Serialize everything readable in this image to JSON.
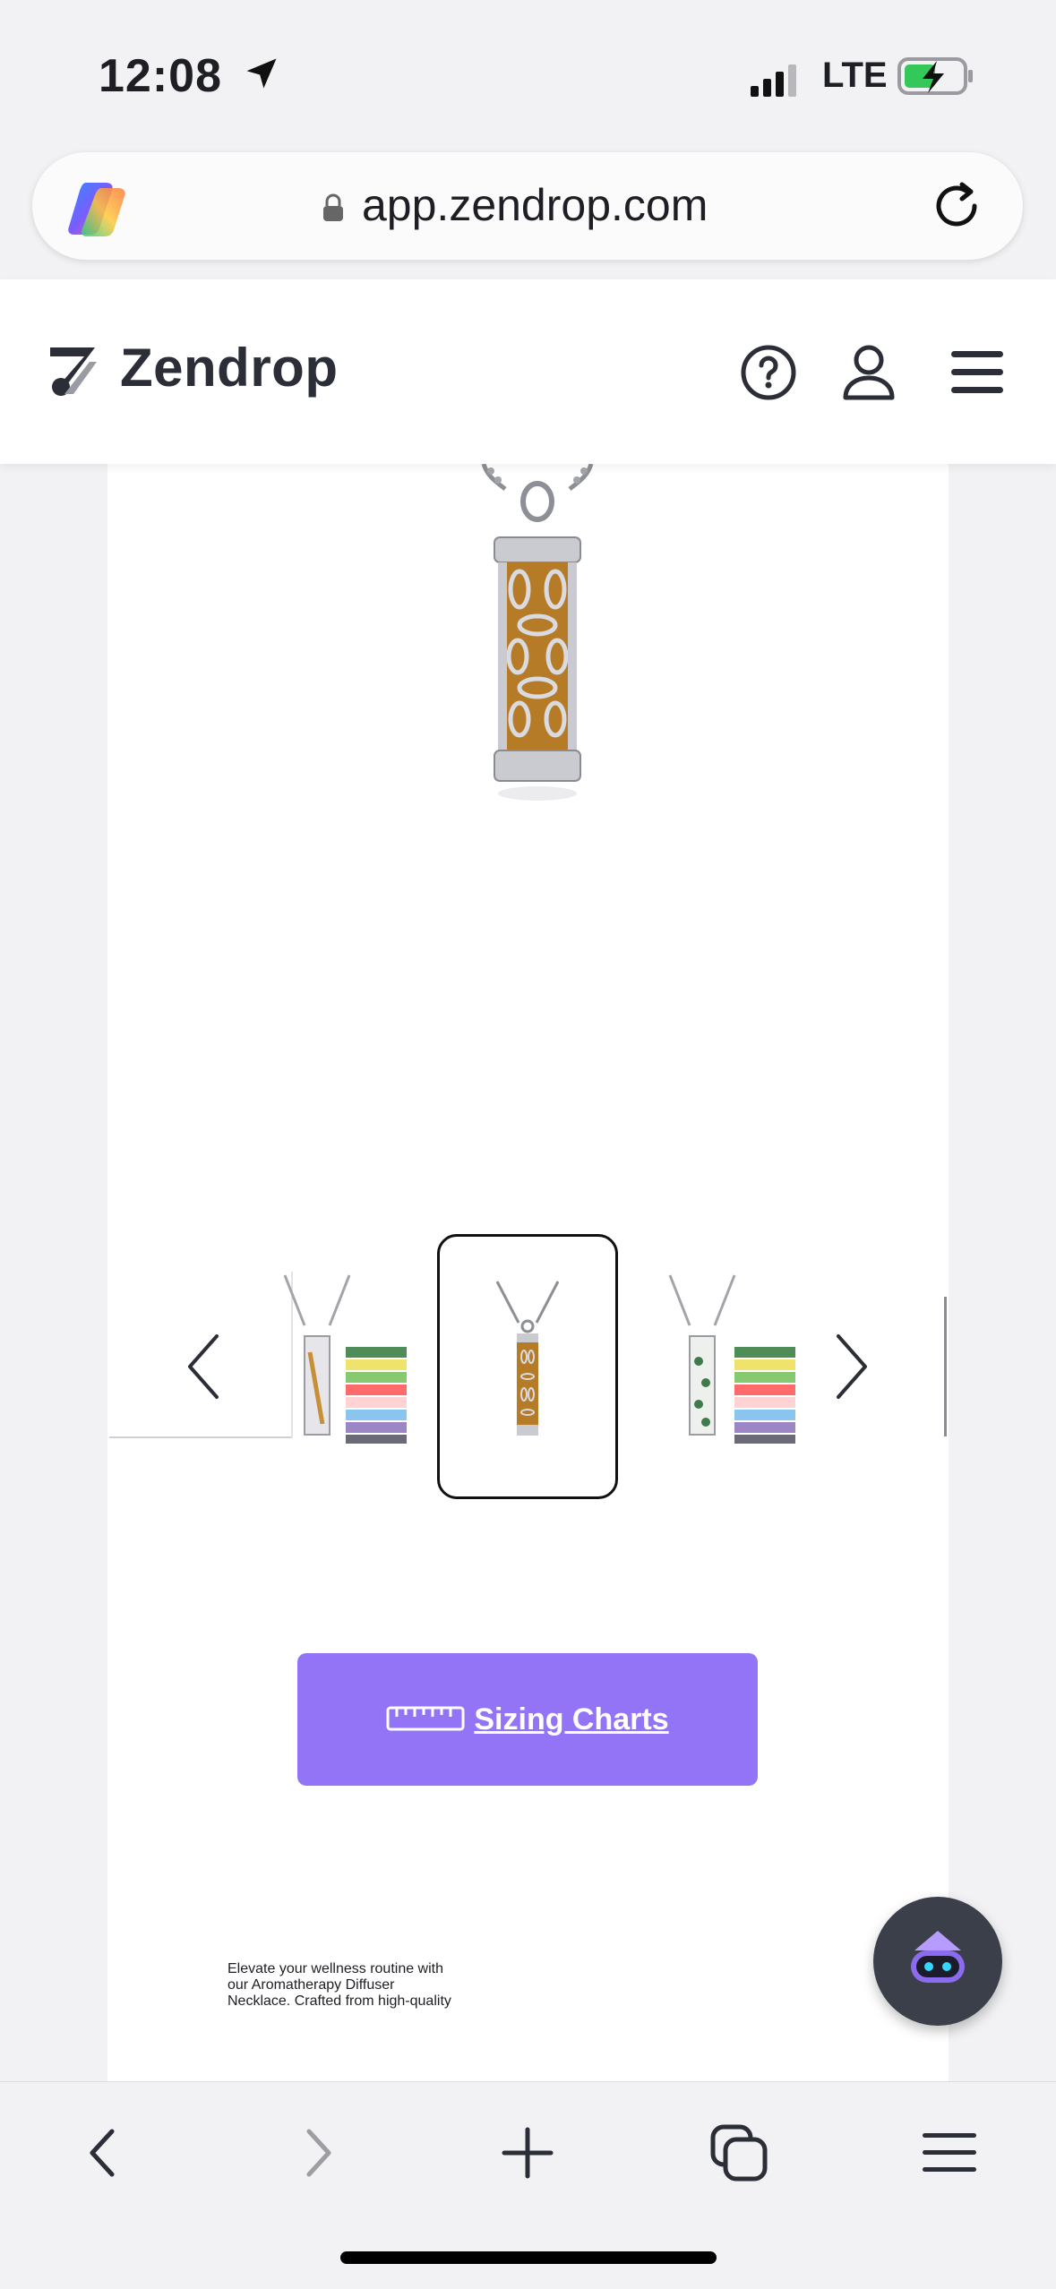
{
  "status_bar": {
    "time": "12:08",
    "network": "LTE",
    "icons": [
      "location-arrow-icon",
      "signal-bars-icon",
      "battery-charging-icon"
    ]
  },
  "browser": {
    "url": "app.zendrop.com",
    "icons": [
      "copilot-logo-icon",
      "lock-icon",
      "reload-icon"
    ]
  },
  "site_header": {
    "brand": "Zendrop",
    "icons": [
      "zendrop-logo-icon",
      "help-icon",
      "user-icon",
      "hamburger-menu-icon"
    ]
  },
  "product": {
    "description_lines": [
      "Elevate your wellness routine with",
      "our Aromatherapy Diffuser",
      "Necklace. Crafted from high-quality"
    ],
    "sizing_button_label": "Sizing Charts",
    "carousel": {
      "selected_index": 1,
      "thumbnail_count": 3
    }
  },
  "toolbar": {
    "items": [
      "back-icon",
      "forward-icon",
      "new-tab-icon",
      "tabs-icon",
      "menu-icon"
    ]
  },
  "colors": {
    "accent": "#9374f7",
    "pendant_amber": "#b57b27",
    "fab_background": "#3b3f4a"
  }
}
